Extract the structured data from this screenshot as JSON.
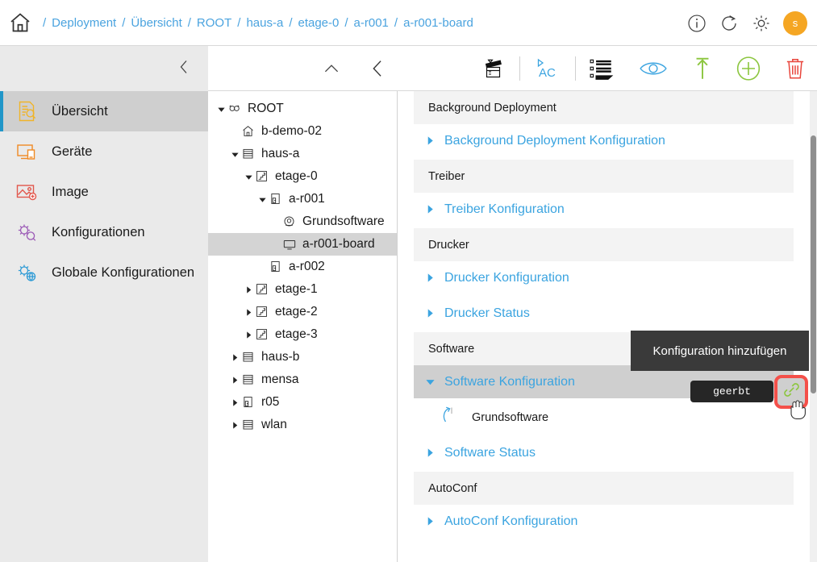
{
  "breadcrumb": {
    "home_icon": "home-icon",
    "separator": "/",
    "items": [
      {
        "label": "Deployment"
      },
      {
        "label": "Übersicht"
      },
      {
        "label": "ROOT"
      },
      {
        "label": "haus-a"
      },
      {
        "label": "etage-0"
      },
      {
        "label": "a-r001"
      },
      {
        "label": "a-r001-board"
      }
    ]
  },
  "topbar_right": {
    "info_icon": "info-icon",
    "refresh_icon": "refresh-icon",
    "settings_icon": "gear-icon",
    "avatar_initial": "s"
  },
  "sidebar": {
    "collapse_icon": "chevron-left-icon",
    "items": [
      {
        "label": "Übersicht",
        "icon": "document-search-icon",
        "active": true
      },
      {
        "label": "Geräte",
        "icon": "devices-icon",
        "active": false
      },
      {
        "label": "Image",
        "icon": "image-icon",
        "active": false
      },
      {
        "label": "Konfigurationen",
        "icon": "gears-search-icon",
        "active": false
      },
      {
        "label": "Globale Konfigurationen",
        "icon": "gear-globe-icon",
        "active": false
      }
    ]
  },
  "toolbar": {
    "buttons": [
      {
        "name": "collapse-up-button",
        "icon": "chevron-up-icon"
      },
      {
        "name": "back-button",
        "icon": "chevron-left-icon"
      },
      {
        "name": "clapperboard-button",
        "icon": "clapperboard-icon"
      },
      {
        "name": "autoconf-button",
        "icon": "ac-play-icon",
        "label": "AC"
      },
      {
        "name": "queue-button",
        "icon": "list-queue-icon"
      },
      {
        "name": "preview-button",
        "icon": "eye-icon"
      },
      {
        "name": "upload-button",
        "icon": "arrow-up-icon"
      },
      {
        "name": "add-button",
        "icon": "plus-circle-icon"
      },
      {
        "name": "delete-button",
        "icon": "trash-icon"
      }
    ]
  },
  "tree": {
    "nodes": [
      {
        "label": "ROOT",
        "icon": "root-icon",
        "depth": 0,
        "twisty": "down",
        "selected": false
      },
      {
        "label": "b-demo-02",
        "icon": "home-icon",
        "depth": 1,
        "twisty": "none",
        "selected": false
      },
      {
        "label": "haus-a",
        "icon": "building-icon",
        "depth": 1,
        "twisty": "down",
        "selected": false
      },
      {
        "label": "etage-0",
        "icon": "stairs-icon",
        "depth": 2,
        "twisty": "down",
        "selected": false
      },
      {
        "label": "a-r001",
        "icon": "room-icon",
        "depth": 3,
        "twisty": "down",
        "selected": false
      },
      {
        "label": "Grundsoftware",
        "icon": "package-icon",
        "depth": 4,
        "twisty": "none",
        "selected": false
      },
      {
        "label": "a-r001-board",
        "icon": "monitor-icon",
        "depth": 4,
        "twisty": "none",
        "selected": true
      },
      {
        "label": "a-r002",
        "icon": "room-icon",
        "depth": 3,
        "twisty": "none",
        "selected": false
      },
      {
        "label": "etage-1",
        "icon": "stairs-icon",
        "depth": 2,
        "twisty": "right",
        "selected": false
      },
      {
        "label": "etage-2",
        "icon": "stairs-icon",
        "depth": 2,
        "twisty": "right",
        "selected": false
      },
      {
        "label": "etage-3",
        "icon": "stairs-icon",
        "depth": 2,
        "twisty": "right",
        "selected": false
      },
      {
        "label": "haus-b",
        "icon": "building-icon",
        "depth": 1,
        "twisty": "right",
        "selected": false
      },
      {
        "label": "mensa",
        "icon": "building-icon",
        "depth": 1,
        "twisty": "right",
        "selected": false
      },
      {
        "label": "r05",
        "icon": "room-icon",
        "depth": 1,
        "twisty": "right",
        "selected": false
      },
      {
        "label": "wlan",
        "icon": "building-icon",
        "depth": 1,
        "twisty": "right",
        "selected": false
      }
    ]
  },
  "content": {
    "sections": [
      {
        "type": "header",
        "label": "Background Deployment"
      },
      {
        "type": "link",
        "label": "Background Deployment Konfiguration",
        "twisty": "right",
        "selected": false
      },
      {
        "type": "header",
        "label": "Treiber"
      },
      {
        "type": "link",
        "label": "Treiber Konfiguration",
        "twisty": "right",
        "selected": false
      },
      {
        "type": "header",
        "label": "Drucker"
      },
      {
        "type": "link",
        "label": "Drucker Konfiguration",
        "twisty": "right",
        "selected": false
      },
      {
        "type": "link",
        "label": "Drucker Status",
        "twisty": "right",
        "selected": false
      },
      {
        "type": "header",
        "label": "Software"
      },
      {
        "type": "link",
        "label": "Software Konfiguration",
        "twisty": "down",
        "selected": true
      },
      {
        "type": "item",
        "label": "Grundsoftware",
        "icon": "inherited-arrow-icon"
      },
      {
        "type": "link",
        "label": "Software Status",
        "twisty": "right",
        "selected": false
      },
      {
        "type": "header",
        "label": "AutoConf"
      },
      {
        "type": "link",
        "label": "AutoConf Konfiguration",
        "twisty": "right",
        "selected": false
      }
    ],
    "inherited_badge": "geerbt",
    "tooltip": "Konfiguration hinzufügen",
    "add_config_icon": "link-chain-icon"
  },
  "colors": {
    "link_blue": "#3ba4e0",
    "accent_blue": "#2196c8",
    "avatar_orange": "#f5a623",
    "highlight_red": "#f4504a",
    "icon_green": "#8cc63f",
    "icon_red": "#e8453c"
  }
}
